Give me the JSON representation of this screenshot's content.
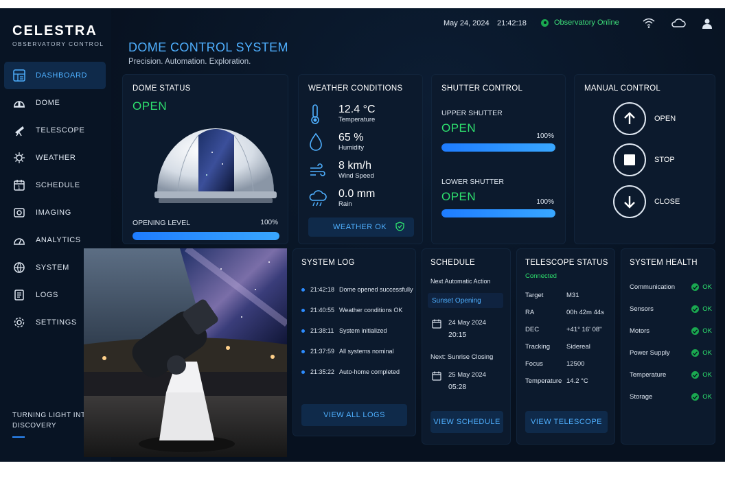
{
  "brand": {
    "name": "CELESTRA",
    "subtitle": "OBSERVATORY CONTROL"
  },
  "sidebar": {
    "items": [
      {
        "label": "DASHBOARD",
        "icon": "dashboard-icon",
        "active": true
      },
      {
        "label": "DOME",
        "icon": "dome-icon"
      },
      {
        "label": "TELESCOPE",
        "icon": "telescope-icon"
      },
      {
        "label": "WEATHER",
        "icon": "weather-icon"
      },
      {
        "label": "SCHEDULE",
        "icon": "schedule-icon"
      },
      {
        "label": "IMAGING",
        "icon": "imaging-icon"
      },
      {
        "label": "ANALYTICS",
        "icon": "analytics-icon"
      },
      {
        "label": "SYSTEM",
        "icon": "system-icon"
      },
      {
        "label": "LOGS",
        "icon": "logs-icon"
      },
      {
        "label": "SETTINGS",
        "icon": "settings-icon"
      }
    ],
    "tagline": "TURNING LIGHT INTO DISCOVERY"
  },
  "topbar": {
    "date": "May 24, 2024",
    "time": "21:42:18",
    "status": "Observatory Online",
    "icons": [
      "wifi-icon",
      "cloud-icon",
      "user-icon"
    ]
  },
  "page": {
    "title": "DOME CONTROL SYSTEM",
    "subtitle": "Precision. Automation. Exploration."
  },
  "dome_status": {
    "title": "DOME STATUS",
    "state": "OPEN",
    "opening_label": "OPENING LEVEL",
    "opening_value": "100%",
    "opening_fraction": 1.0
  },
  "weather": {
    "title": "WEATHER CONDITIONS",
    "items": [
      {
        "value": "12.4 °C",
        "label": "Temperature",
        "icon": "thermometer-icon"
      },
      {
        "value": "65 %",
        "label": "Humidity",
        "icon": "droplet-icon"
      },
      {
        "value": "8 km/h",
        "label": "Wind Speed",
        "icon": "wind-icon"
      },
      {
        "value": "0.0 mm",
        "label": "Rain",
        "icon": "rain-cloud-icon"
      }
    ],
    "status": "WEATHER OK"
  },
  "shutter": {
    "title": "SHUTTER CONTROL",
    "upper": {
      "label": "UPPER SHUTTER",
      "state": "OPEN",
      "value": "100%",
      "fraction": 1.0
    },
    "lower": {
      "label": "LOWER SHUTTER",
      "state": "OPEN",
      "value": "100%",
      "fraction": 1.0
    }
  },
  "manual": {
    "title": "MANUAL CONTROL",
    "open": "OPEN",
    "stop": "STOP",
    "close": "CLOSE"
  },
  "system_log": {
    "title": "SYSTEM LOG",
    "entries": [
      {
        "time": "21:42:18",
        "msg": "Dome opened successfully"
      },
      {
        "time": "21:40:55",
        "msg": "Weather conditions OK"
      },
      {
        "time": "21:38:11",
        "msg": "System initialized"
      },
      {
        "time": "21:37:59",
        "msg": "All systems nominal"
      },
      {
        "time": "21:35:22",
        "msg": "Auto-home completed"
      }
    ],
    "button": "VIEW ALL LOGS"
  },
  "schedule": {
    "title": "SCHEDULE",
    "next_label": "Next Automatic Action",
    "next_action": "Sunset Opening",
    "first": {
      "date": "24 May 2024",
      "time": "20:15"
    },
    "second_label": "Next: Sunrise Closing",
    "second": {
      "date": "25 May 2024",
      "time": "05:28"
    },
    "button": "VIEW SCHEDULE"
  },
  "telescope": {
    "title": "TELESCOPE STATUS",
    "status": "Connected",
    "rows": [
      {
        "key": "Target",
        "val": "M31"
      },
      {
        "key": "RA",
        "val": "00h 42m 44s"
      },
      {
        "key": "DEC",
        "val": "+41° 16' 08\""
      },
      {
        "key": "Tracking",
        "val": "Sidereal"
      },
      {
        "key": "Focus",
        "val": "12500"
      },
      {
        "key": "Temperature",
        "val": "14.2 °C"
      }
    ],
    "button": "VIEW TELESCOPE"
  },
  "health": {
    "title": "SYSTEM HEALTH",
    "rows": [
      {
        "key": "Communication",
        "val": "OK"
      },
      {
        "key": "Sensors",
        "val": "OK"
      },
      {
        "key": "Motors",
        "val": "OK"
      },
      {
        "key": "Power Supply",
        "val": "OK"
      },
      {
        "key": "Temperature",
        "val": "OK"
      },
      {
        "key": "Storage",
        "val": "OK"
      }
    ]
  },
  "colors": {
    "accent": "#4fb0ff",
    "ok": "#2ee06e",
    "background": "#07111f",
    "card": "#0c1a2d"
  }
}
